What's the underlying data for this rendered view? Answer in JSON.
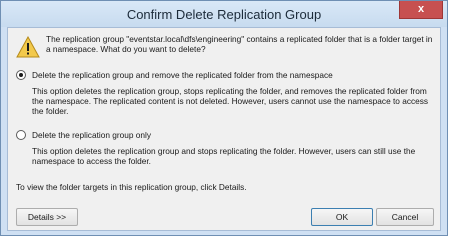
{
  "window": {
    "title": "Confirm Delete Replication Group",
    "close_glyph": "x"
  },
  "message": "The replication group \"eventstar.local\\dfs\\engineering\" contains a replicated folder that is a folder target in a namespace. What do you want to delete?",
  "icons": {
    "warning": "warning-icon",
    "close": "close-icon"
  },
  "options": [
    {
      "label": "Delete the replication group and remove the replicated folder from the namespace",
      "selected": true,
      "description": "This option deletes the replication group, stops replicating the folder, and removes the replicated folder from the namespace. The replicated content is not deleted. However, users cannot use the namespace to access the folder."
    },
    {
      "label": "Delete the replication group only",
      "selected": false,
      "description": "This option deletes the replication group and stops replicating the folder. However, users can still use the namespace to access the folder."
    }
  ],
  "details_text": "To view the folder targets in this replication group, click Details.",
  "buttons": {
    "details": "Details >>",
    "ok": "OK",
    "cancel": "Cancel"
  },
  "colors": {
    "frame": "#cfe0f3",
    "close_button": "#c75050",
    "client_bg": "#f0f0f0",
    "warning_fill": "#f2c94c"
  }
}
